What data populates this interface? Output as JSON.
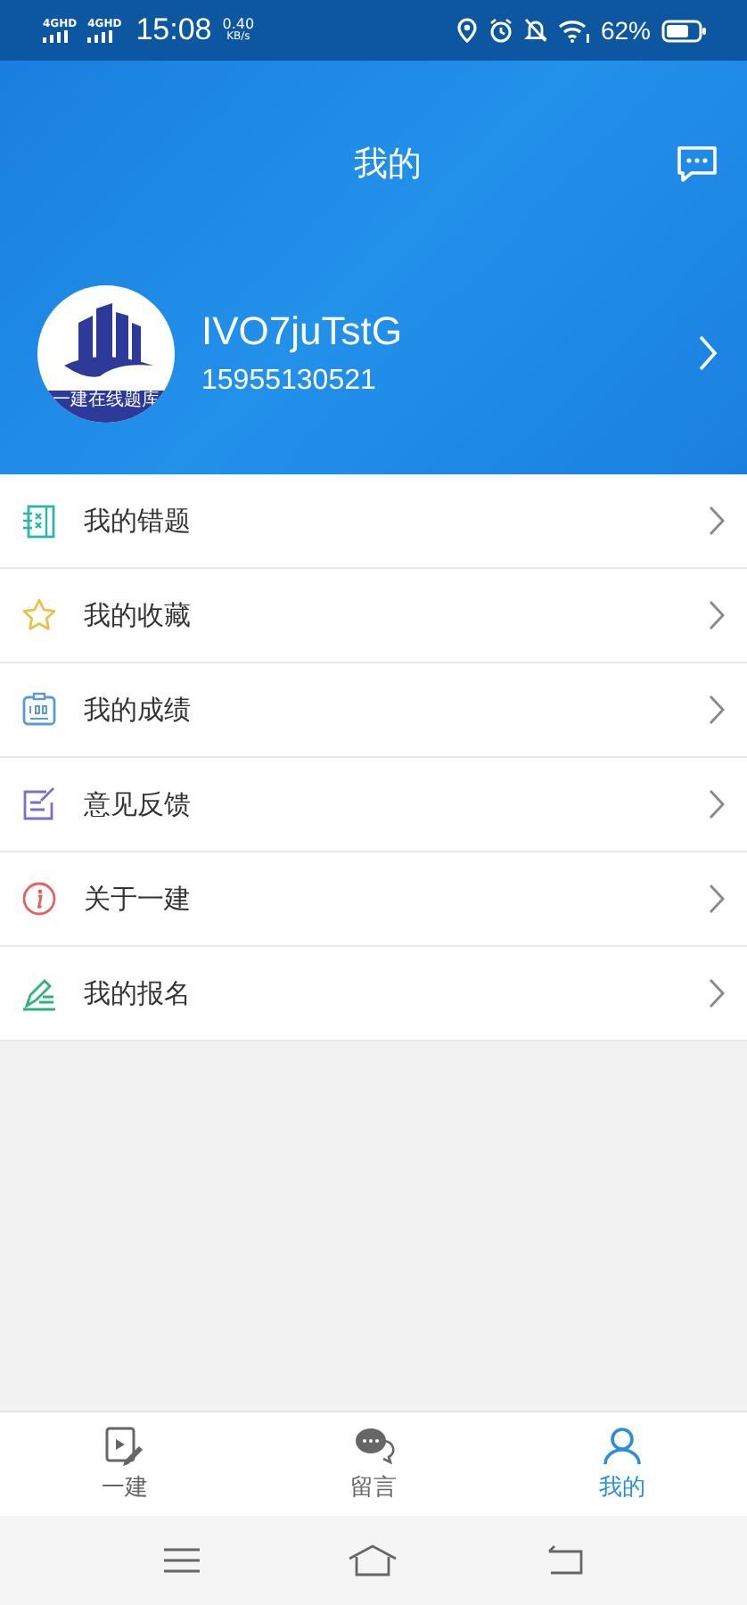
{
  "status_bar": {
    "networks": [
      "4GHD",
      "4GHD"
    ],
    "time": "15:08",
    "speed": "0.40",
    "speed_unit": "KB/s",
    "battery": "62%"
  },
  "header": {
    "title": "我的"
  },
  "profile": {
    "name": "IVO7juTstG",
    "phone": "15955130521",
    "logo_caption": "一建在线题库"
  },
  "menu": [
    {
      "kind": "mistakes",
      "label": "我的错题"
    },
    {
      "kind": "favorites",
      "label": "我的收藏"
    },
    {
      "kind": "scores",
      "label": "我的成绩"
    },
    {
      "kind": "feedback",
      "label": "意见反馈"
    },
    {
      "kind": "about",
      "label": "关于一建"
    },
    {
      "kind": "signup",
      "label": "我的报名"
    }
  ],
  "tabs": [
    {
      "kind": "study",
      "label": "一建",
      "selected": false
    },
    {
      "kind": "messages",
      "label": "留言",
      "selected": false
    },
    {
      "kind": "profile",
      "label": "我的",
      "selected": true
    }
  ]
}
